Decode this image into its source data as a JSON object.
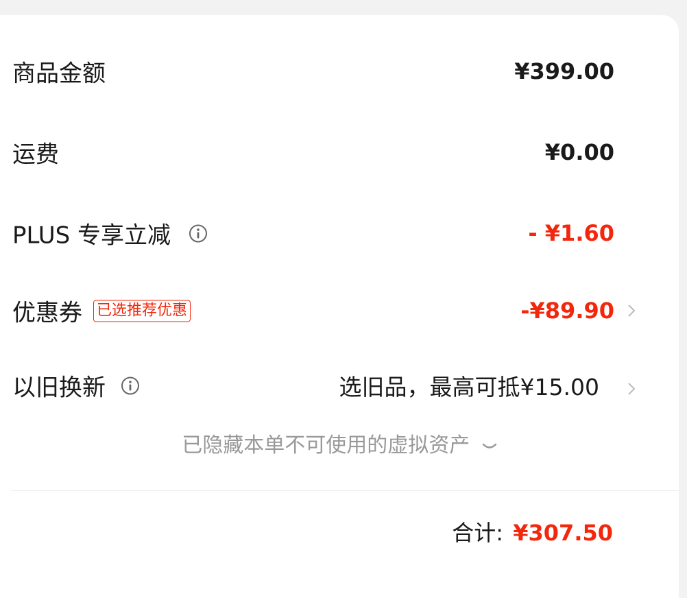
{
  "rows": {
    "goods_amount": {
      "label": "商品金额",
      "value": "¥399.00"
    },
    "shipping": {
      "label": "运费",
      "value": "¥0.00"
    },
    "plus_discount": {
      "label": "PLUS 专享立减",
      "value": "- ¥1.60",
      "icon": "info-icon"
    },
    "coupon": {
      "label": "优惠券",
      "tag": "已选推荐优惠",
      "value": "-¥89.90",
      "icon": "chevron-right-icon"
    },
    "trade_in": {
      "label": "以旧换新",
      "value": "选旧品，最高可抵¥15.00",
      "icon": "info-icon"
    }
  },
  "hidden_assets": {
    "text": "已隐藏本单不可使用的虚拟资产",
    "icon": "chevron-down-icon"
  },
  "total": {
    "label": "合计:",
    "value": "¥307.50"
  },
  "colors": {
    "accent_red": "#f2270c",
    "text_primary": "#1a1a1a",
    "text_secondary": "#999999",
    "background": "#f2f2f2"
  }
}
